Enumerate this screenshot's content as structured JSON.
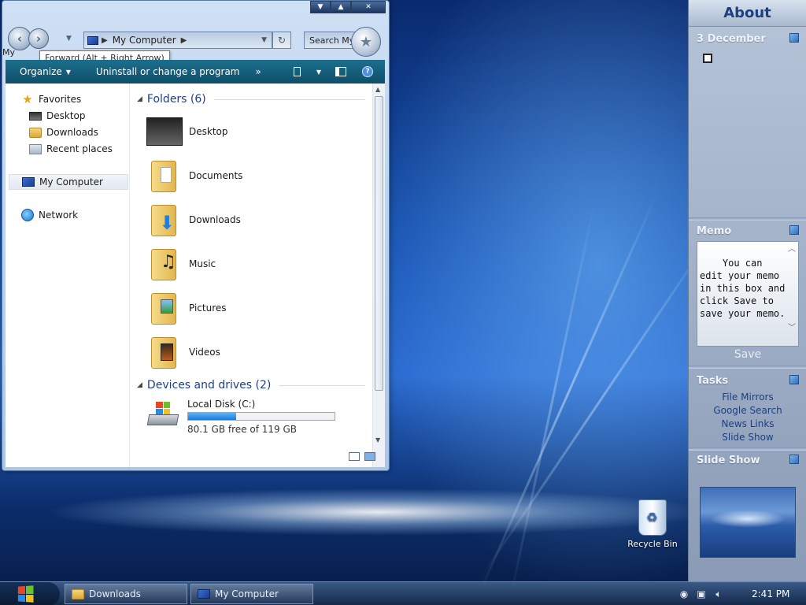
{
  "explorer": {
    "window_buttons": {
      "minimize": "▼",
      "maximize": "▲",
      "close": "✕"
    },
    "nav": {
      "back": "‹",
      "forward": "›"
    },
    "my_label": "My",
    "tooltip": "Forward (Alt + Right Arrow)",
    "address": {
      "path": "My Computer"
    },
    "search": {
      "placeholder": "Search My Co..."
    },
    "toolbar": {
      "organize": "Organize",
      "uninstall": "Uninstall or change a program",
      "more": "»"
    },
    "nav_pane": {
      "favorites": "Favorites",
      "desktop": "Desktop",
      "downloads": "Downloads",
      "recent": "Recent places",
      "computer": "My Computer",
      "network": "Network"
    },
    "folders_header": "Folders (6)",
    "folders": [
      {
        "name": "Desktop"
      },
      {
        "name": "Documents"
      },
      {
        "name": "Downloads"
      },
      {
        "name": "Music"
      },
      {
        "name": "Pictures"
      },
      {
        "name": "Videos"
      }
    ],
    "devices_header": "Devices and drives (2)",
    "drive": {
      "name": "Local Disk (C:)",
      "free_text": "80.1 GB free of 119 GB",
      "used_fraction": 0.327
    }
  },
  "sidebar": {
    "title": "About",
    "calendar_date": "3 December",
    "memo_label": "Memo",
    "memo_text": "You can edit your memo in this box and click Save to save your memo.",
    "memo_save": "Save",
    "tasks_label": "Tasks",
    "tasks": [
      "File Mirrors",
      "Google Search",
      "News Links",
      "Slide Show"
    ],
    "slideshow_label": "Slide Show"
  },
  "desktop": {
    "recycle_bin": "Recycle Bin"
  },
  "taskbar": {
    "tasks": [
      {
        "label": "Downloads"
      },
      {
        "label": "My Computer"
      }
    ],
    "clock": "2:41 PM"
  }
}
